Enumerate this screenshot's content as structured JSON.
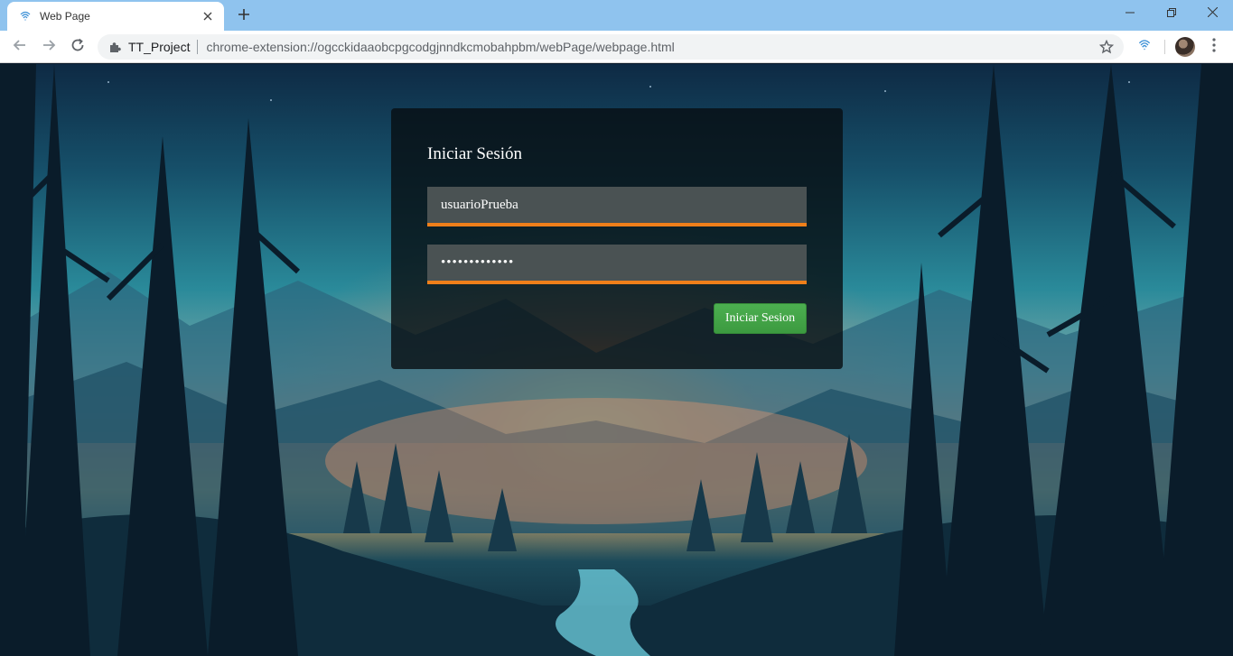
{
  "browser": {
    "tab": {
      "title": "Web Page",
      "favicon": "fingerprint-icon",
      "close_icon": "close-icon"
    },
    "new_tab_icon": "plus-icon",
    "window_controls": [
      "minimize-icon",
      "restore-icon",
      "close-icon"
    ],
    "nav": [
      "back-icon",
      "forward-icon",
      "reload-icon"
    ],
    "address": {
      "extension_icon": "puzzle-icon",
      "extension_name": "TT_Project",
      "url": "chrome-extension://ogcckidaaobcpgcodgjnndkcmobahpbm/webPage/webpage.html",
      "bookmark_icon": "star-icon"
    },
    "toolbar_icons": [
      "extension-fingerprint-icon",
      "avatar",
      "more-menu-icon"
    ]
  },
  "login": {
    "title": "Iniciar Sesión",
    "username_value": "usuarioPrueba",
    "password_value": "•••••••••••••",
    "submit_label": "Iniciar Sesion"
  },
  "colors": {
    "titlebar": "#8fc3ee",
    "input_bg": "#4a5253",
    "input_underline": "#ef7f1a",
    "button_green": "#4caf50",
    "card_bg": "rgba(8,14,18,0.80)"
  }
}
